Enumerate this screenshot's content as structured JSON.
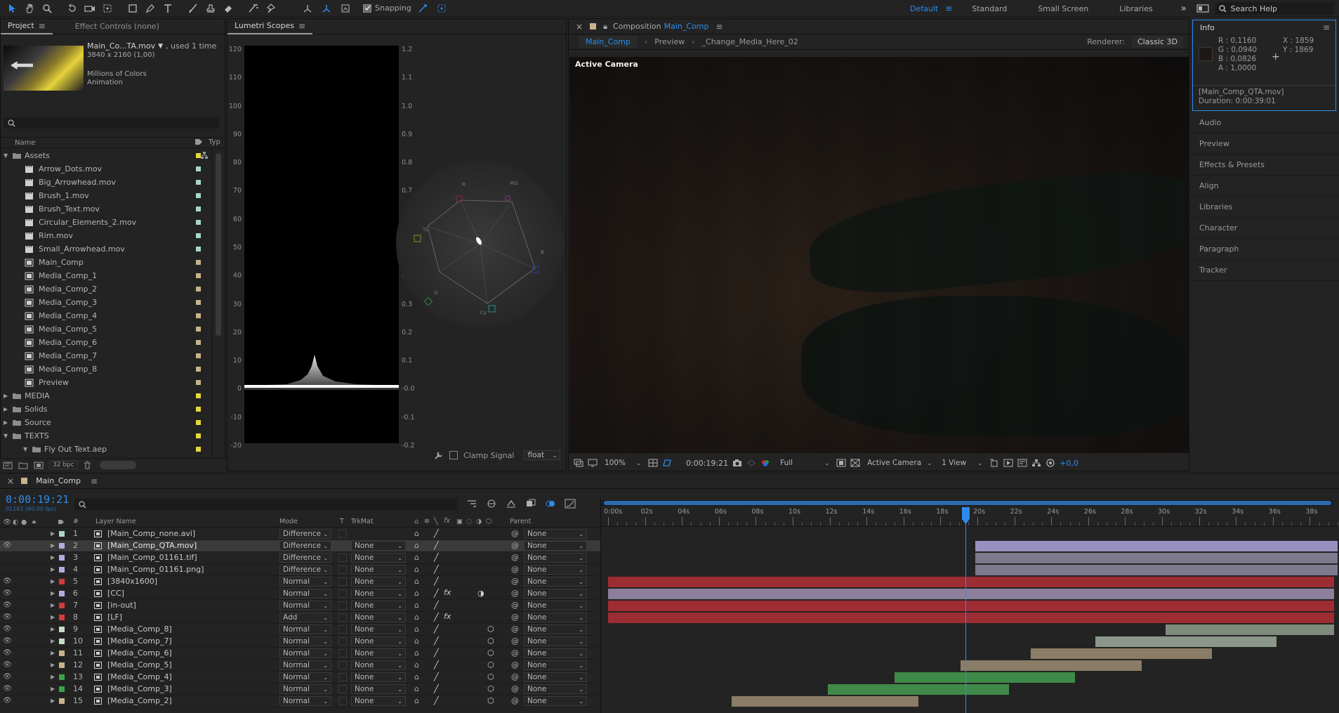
{
  "toolbar": {
    "snapping_label": "Snapping",
    "workspaces": [
      "Default",
      "Standard",
      "Small Screen",
      "Libraries"
    ],
    "search_placeholder": "Search Help"
  },
  "project_panel": {
    "tabs": [
      "Project",
      "Effect Controls (none)"
    ],
    "selected_name": "Main_Co...TA.mov",
    "used_text": ", used 1 time",
    "dimensions": "3840 x 2160 (1,00)",
    "colors": "Millions of Colors",
    "codec": "Animation",
    "col_name": "Name",
    "col_type": "Typ",
    "bpc": "32 bpc",
    "items": [
      {
        "label": "Assets",
        "kind": "folder",
        "indent": 0,
        "open": true,
        "color": "#e6d93a"
      },
      {
        "label": "Arrow_Dots.mov",
        "kind": "movie",
        "indent": 1,
        "color": "#a9d6cf"
      },
      {
        "label": "Big_Arrowhead.mov",
        "kind": "movie",
        "indent": 1,
        "color": "#a9d6cf"
      },
      {
        "label": "Brush_1.mov",
        "kind": "movie",
        "indent": 1,
        "color": "#a9d6cf"
      },
      {
        "label": "Brush_Text.mov",
        "kind": "movie",
        "indent": 1,
        "color": "#a9d6cf"
      },
      {
        "label": "Circular_Elements_2.mov",
        "kind": "movie",
        "indent": 1,
        "color": "#a9d6cf"
      },
      {
        "label": "Rim.mov",
        "kind": "movie",
        "indent": 1,
        "color": "#a9d6cf"
      },
      {
        "label": "Small_Arrowhead.mov",
        "kind": "movie",
        "indent": 1,
        "color": "#a9d6cf"
      },
      {
        "label": "Main_Comp",
        "kind": "comp",
        "indent": 1,
        "color": "#c9b38a"
      },
      {
        "label": "Media_Comp_1",
        "kind": "comp",
        "indent": 1,
        "color": "#c9b38a"
      },
      {
        "label": "Media_Comp_2",
        "kind": "comp",
        "indent": 1,
        "color": "#c9b38a"
      },
      {
        "label": "Media_Comp_3",
        "kind": "comp",
        "indent": 1,
        "color": "#c9b38a"
      },
      {
        "label": "Media_Comp_4",
        "kind": "comp",
        "indent": 1,
        "color": "#c9b38a"
      },
      {
        "label": "Media_Comp_5",
        "kind": "comp",
        "indent": 1,
        "color": "#c9b38a"
      },
      {
        "label": "Media_Comp_6",
        "kind": "comp",
        "indent": 1,
        "color": "#c9b38a"
      },
      {
        "label": "Media_Comp_7",
        "kind": "comp",
        "indent": 1,
        "color": "#c9b38a"
      },
      {
        "label": "Media_Comp_8",
        "kind": "comp",
        "indent": 1,
        "color": "#c9b38a"
      },
      {
        "label": "Preview",
        "kind": "comp",
        "indent": 1,
        "color": "#c9b38a"
      },
      {
        "label": "MEDIA",
        "kind": "folder",
        "indent": 0,
        "open": false,
        "color": "#e6d93a"
      },
      {
        "label": "Solids",
        "kind": "folder",
        "indent": 0,
        "open": false,
        "color": "#e6d93a"
      },
      {
        "label": "Source",
        "kind": "folder",
        "indent": 0,
        "open": false,
        "color": "#e6d93a"
      },
      {
        "label": "TEXTS",
        "kind": "folder",
        "indent": 0,
        "open": true,
        "color": "#e6d93a"
      },
      {
        "label": "Fly Out Text.aep",
        "kind": "folder",
        "indent": 1,
        "open": true,
        "color": "#e6d93a"
      }
    ]
  },
  "scopes": {
    "title": "Lumetri Scopes",
    "left_ticks": [
      "120",
      "110",
      "100",
      "90",
      "80",
      "70",
      "60",
      "50",
      "40",
      "30",
      "20",
      "10",
      "0",
      "-10",
      "-20"
    ],
    "right_ticks": [
      "1.2",
      "1.1",
      "1.0",
      "0.9",
      "0.8",
      "0.7",
      "0.6",
      "0.5",
      "0.4",
      "0.3",
      "0.2",
      "0.1",
      "-0.0",
      "-0.1",
      "-0.2"
    ],
    "clamp_label": "Clamp Signal",
    "float_label": "float",
    "wheel_labels": [
      "R",
      "MG",
      "B",
      "Cy",
      "G",
      "YL"
    ]
  },
  "composition": {
    "title_prefix": "Composition",
    "title_name": "Main_Comp",
    "crumb_active": "Main_Comp",
    "crumb_preview": "Preview",
    "crumb_media": "_Change_Media_Here_02",
    "renderer_label": "Renderer:",
    "renderer_value": "Classic 3D",
    "overlay_label": "Active Camera",
    "zoom": "100%",
    "timecode": "0:00:19:21",
    "resolution": "Full",
    "camera": "Active Camera",
    "views": "1 View",
    "exposure": "+0,0"
  },
  "info": {
    "title": "Info",
    "r": "R :  0,1160",
    "g": "G :  0,0940",
    "b": "B :  0,0826",
    "a": "A :  1,0000",
    "x": "X : 1859",
    "y": "Y : 1869",
    "file": "[Main_Comp_QTA.mov]",
    "duration": "Duration: 0:00:39:01",
    "swatch": "#1d1815"
  },
  "right_panels": [
    "Audio",
    "Preview",
    "Effects & Presets",
    "Align",
    "Libraries",
    "Character",
    "Paragraph",
    "Tracker"
  ],
  "timeline": {
    "tab": "Main_Comp",
    "timecode": "0:00:19:21",
    "frame": "01161 (60.00 fps)",
    "headers": {
      "layer": "Layer Name",
      "mode": "Mode",
      "t": "T",
      "trkmat": "TrkMat",
      "parent": "Parent"
    },
    "ruler": [
      "0:00s",
      "02s",
      "04s",
      "06s",
      "08s",
      "10s",
      "12s",
      "14s",
      "16s",
      "18s",
      "20s",
      "22s",
      "24s",
      "26s",
      "28s",
      "30s",
      "32s",
      "34s",
      "36s",
      "38s"
    ],
    "layers": [
      {
        "num": "1",
        "name": "[Main_Comp_none.avi]",
        "mode": "Difference",
        "trk": "",
        "parent": "None",
        "color": "#a9d6cf",
        "eye": false,
        "fx": false,
        "three_d": false,
        "sel": false
      },
      {
        "num": "2",
        "name": "[Main_Comp_QTA.mov]",
        "mode": "Difference",
        "trk": "None",
        "parent": "None",
        "color": "#b9a8e0",
        "eye": true,
        "fx": false,
        "three_d": false,
        "sel": true
      },
      {
        "num": "3",
        "name": "[Main_Comp_01161.tif]",
        "mode": "Difference",
        "trk": "None",
        "parent": "None",
        "color": "#b9a8e0",
        "eye": false,
        "fx": false,
        "three_d": false,
        "sel": false
      },
      {
        "num": "4",
        "name": "[Main_Comp_01161.png]",
        "mode": "Difference",
        "trk": "None",
        "parent": "None",
        "color": "#b9a8e0",
        "eye": false,
        "fx": false,
        "three_d": false,
        "sel": false
      },
      {
        "num": "5",
        "name": "[3840x1600]",
        "mode": "Normal",
        "trk": "None",
        "parent": "None",
        "color": "#d33a3a",
        "eye": true,
        "fx": false,
        "three_d": false,
        "sel": false
      },
      {
        "num": "6",
        "name": "[CC]",
        "mode": "Normal",
        "trk": "None",
        "parent": "None",
        "color": "#b9a8e0",
        "eye": true,
        "fx": true,
        "three_d": false,
        "sel": false
      },
      {
        "num": "7",
        "name": "[in-out]",
        "mode": "Normal",
        "trk": "None",
        "parent": "None",
        "color": "#d33a3a",
        "eye": true,
        "fx": false,
        "three_d": false,
        "sel": false
      },
      {
        "num": "8",
        "name": "[LF]",
        "mode": "Add",
        "trk": "None",
        "parent": "None",
        "color": "#d33a3a",
        "eye": true,
        "fx": true,
        "three_d": false,
        "sel": false
      },
      {
        "num": "9",
        "name": "[Media_Comp_8]",
        "mode": "Normal",
        "trk": "None",
        "parent": "None",
        "color": "#c7dcc4",
        "eye": true,
        "fx": false,
        "three_d": true,
        "sel": false
      },
      {
        "num": "10",
        "name": "[Media_Comp_7]",
        "mode": "Normal",
        "trk": "None",
        "parent": "None",
        "color": "#c7dcc4",
        "eye": true,
        "fx": false,
        "three_d": true,
        "sel": false
      },
      {
        "num": "11",
        "name": "[Media_Comp_6]",
        "mode": "Normal",
        "trk": "None",
        "parent": "None",
        "color": "#c9b38a",
        "eye": true,
        "fx": false,
        "three_d": true,
        "sel": false
      },
      {
        "num": "12",
        "name": "[Media_Comp_5]",
        "mode": "Normal",
        "trk": "None",
        "parent": "None",
        "color": "#c9b38a",
        "eye": true,
        "fx": false,
        "three_d": true,
        "sel": false
      },
      {
        "num": "13",
        "name": "[Media_Comp_4]",
        "mode": "Normal",
        "trk": "None",
        "parent": "None",
        "color": "#3aa34a",
        "eye": true,
        "fx": false,
        "three_d": true,
        "sel": false
      },
      {
        "num": "14",
        "name": "[Media_Comp_3]",
        "mode": "Normal",
        "trk": "None",
        "parent": "None",
        "color": "#3aa34a",
        "eye": true,
        "fx": false,
        "three_d": true,
        "sel": false
      },
      {
        "num": "15",
        "name": "[Media_Comp_2]",
        "mode": "Normal",
        "trk": "None",
        "parent": "None",
        "color": "#c9b38a",
        "eye": true,
        "fx": false,
        "three_d": true,
        "sel": false
      }
    ],
    "bars": [
      {
        "row": 0,
        "start": 0,
        "end": 0,
        "color": "#262626"
      },
      {
        "row": 1,
        "start": 19.9,
        "end": 39.5,
        "color": "#9a90c0"
      },
      {
        "row": 2,
        "start": 19.9,
        "end": 39.5,
        "color": "#7d7a8e"
      },
      {
        "row": 3,
        "start": 19.9,
        "end": 39.5,
        "color": "#7d7a8e"
      },
      {
        "row": 4,
        "start": 0,
        "end": 39.3,
        "color": "#9e2c33"
      },
      {
        "row": 5,
        "start": 0,
        "end": 39.3,
        "color": "#8c7f9c"
      },
      {
        "row": 6,
        "start": 0,
        "end": 39.3,
        "color": "#9e2c33"
      },
      {
        "row": 7,
        "start": 0,
        "end": 39.3,
        "color": "#9e2c33"
      },
      {
        "row": 8,
        "start": 30.2,
        "end": 39.3,
        "color": "#7e8c7c"
      },
      {
        "row": 9,
        "start": 26.4,
        "end": 36.2,
        "color": "#8a978a"
      },
      {
        "row": 10,
        "start": 22.9,
        "end": 32.7,
        "color": "#8a7c65"
      },
      {
        "row": 11,
        "start": 19.1,
        "end": 28.9,
        "color": "#8a7c65"
      },
      {
        "row": 12,
        "start": 15.5,
        "end": 25.3,
        "color": "#3f8a48"
      },
      {
        "row": 13,
        "start": 11.9,
        "end": 21.7,
        "color": "#3f8a48"
      },
      {
        "row": 14,
        "start": 6.7,
        "end": 16.8,
        "color": "#8a7c65"
      }
    ]
  }
}
